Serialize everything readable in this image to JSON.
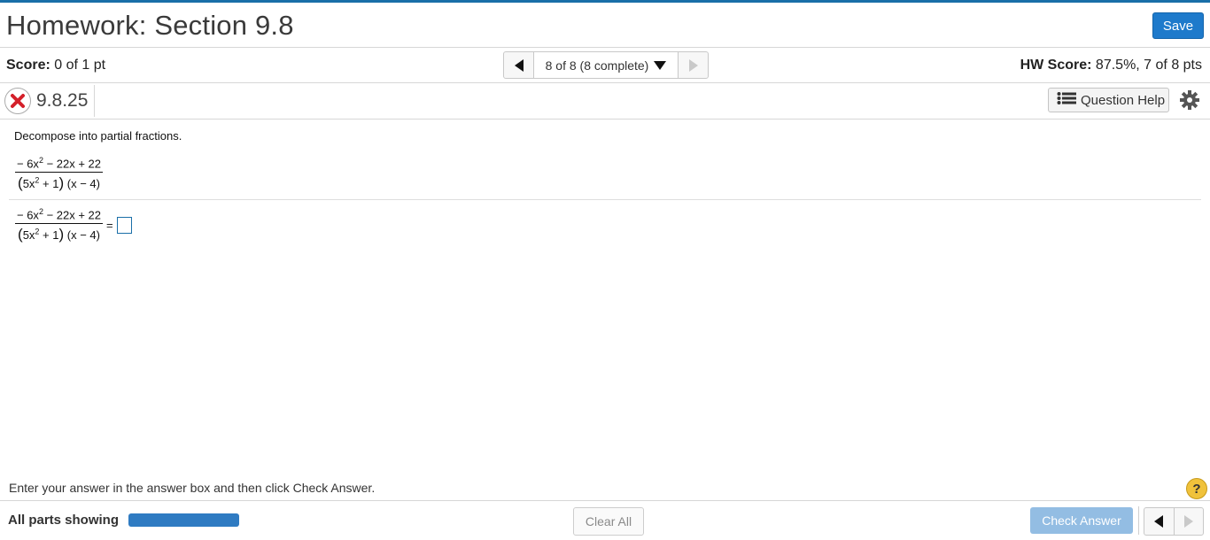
{
  "header": {
    "title": "Homework: Section 9.8",
    "save_label": "Save"
  },
  "scorebar": {
    "score_label": "Score:",
    "score_value": "0 of 1 pt",
    "nav_label": "8 of 8 (8 complete)",
    "hw_score_label": "HW Score:",
    "hw_score_value": "87.5%, 7 of 8 pts"
  },
  "question": {
    "number": "9.8.25",
    "help_label": "Question Help",
    "status": "incorrect"
  },
  "content": {
    "instruction": "Decompose into partial fractions.",
    "numerator": {
      "a": "− 6x",
      "exp": "2",
      "b": " − 22x + 22"
    },
    "denominator": {
      "open": "(",
      "a": "5x",
      "exp": "2",
      "b": " + 1",
      "close": ")",
      "c": " (x − 4)"
    },
    "equals": "="
  },
  "footer": {
    "instruction": "Enter your answer in the answer box and then click Check Answer.",
    "help_glyph": "?",
    "all_parts_label": "All parts showing",
    "progress": 1.0,
    "clear_all_label": "Clear All",
    "check_answer_label": "Check Answer"
  },
  "colors": {
    "accent": "#1e7acb",
    "top_border": "#1a6fa8",
    "check_disabled": "#93bde3",
    "help": "#f0c23b"
  },
  "icons": [
    "x-circle-icon",
    "list-icon",
    "gear-icon",
    "question-icon",
    "triangle-left-icon",
    "triangle-right-icon",
    "triangle-down-icon"
  ]
}
